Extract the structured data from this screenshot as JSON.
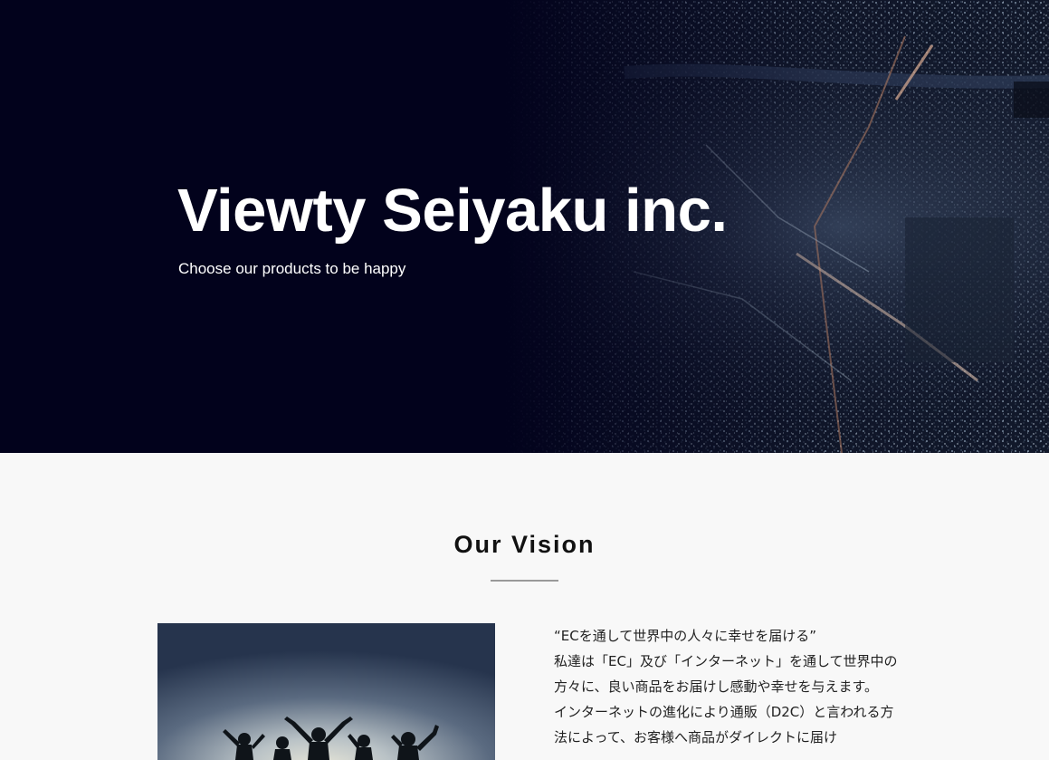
{
  "hero": {
    "title": "Viewty Seiyaku inc.",
    "subtitle": "Choose our products to be happy",
    "background_color": "#02021c"
  },
  "vision": {
    "heading": "Our Vision",
    "quote": "“ECを通して世界中の人々に幸せを届ける”",
    "paragraph_1": "私達は「EC」及び「インターネット」を通して世界中の方々に、良い商品をお届けし感動や幸せを与えます。",
    "paragraph_2": "インターネットの進化により通販（D2C）と言われる方法によって、お客様へ商品がダイレクトに届け",
    "background_color": "#f8f8f8"
  }
}
